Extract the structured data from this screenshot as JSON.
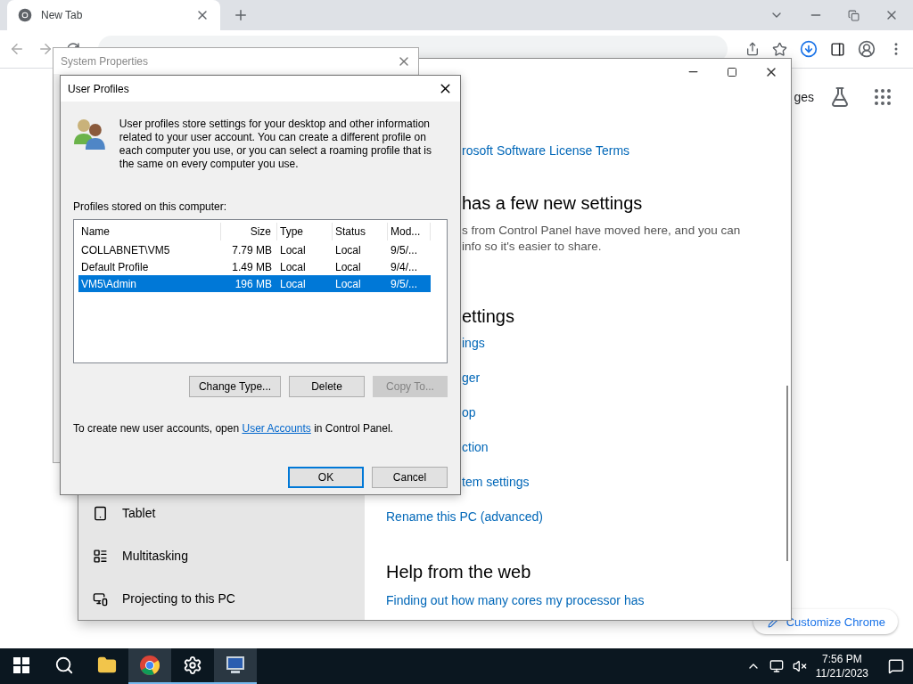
{
  "browser": {
    "tabs": [
      {
        "title": "New Tab",
        "selected": true
      }
    ],
    "page": {
      "header_link": "ges",
      "customize_button": "Customize Chrome"
    }
  },
  "settings_window": {
    "link_top": "rosoft Software License Terms",
    "heading_1": "has a few new settings",
    "description": [
      "s from Control Panel have moved here, and you can",
      "info so it's easier to share."
    ],
    "heading_2": "ettings",
    "related_links": [
      "ings",
      "ger",
      "op",
      "ction",
      "tem settings"
    ],
    "rename_link": "Rename this PC (advanced)",
    "help_heading": "Help from the web",
    "help_links": [
      "Finding out how many cores my processor has"
    ],
    "nav_items": [
      {
        "label": "Tablet"
      },
      {
        "label": "Multitasking"
      },
      {
        "label": "Projecting to this PC"
      }
    ]
  },
  "system_properties": {
    "title": "System Properties"
  },
  "user_profiles": {
    "title": "User Profiles",
    "description": "User profiles store settings for your desktop and other information related to your user account. You can create a different profile on each computer you use, or you can select a roaming profile that is the same on every computer you use.",
    "list_label": "Profiles stored on this computer:",
    "columns": [
      "Name",
      "Size",
      "Type",
      "Status",
      "Mod..."
    ],
    "rows": [
      {
        "cells": [
          "COLLABNET\\VM5",
          "7.79 MB",
          "Local",
          "Local",
          "9/5/..."
        ],
        "selected": false
      },
      {
        "cells": [
          "Default Profile",
          "1.49 MB",
          "Local",
          "Local",
          "9/4/..."
        ],
        "selected": false
      },
      {
        "cells": [
          "VM5\\Admin",
          "196 MB",
          "Local",
          "Local",
          "9/5/..."
        ],
        "selected": true
      }
    ],
    "buttons": [
      {
        "label": "Change Type...",
        "disabled": false
      },
      {
        "label": "Delete",
        "disabled": false
      },
      {
        "label": "Copy To...",
        "disabled": true
      }
    ],
    "footer_before": "To create new user accounts, open",
    "footer_link": "User Accounts",
    "footer_after": "in Control Panel.",
    "dialog_buttons": [
      {
        "label": "OK",
        "default": true
      },
      {
        "label": "Cancel",
        "default": false
      }
    ]
  },
  "taskbar": {
    "apps": [
      {
        "kind": "search",
        "open": false,
        "focused": false
      },
      {
        "kind": "explorer",
        "open": false,
        "focused": false
      },
      {
        "kind": "chrome",
        "open": true,
        "focused": true
      },
      {
        "kind": "settings",
        "open": true,
        "focused": false
      },
      {
        "kind": "system",
        "open": true,
        "focused": true
      }
    ],
    "time": "7:56 PM",
    "date": "11/21/2023"
  }
}
